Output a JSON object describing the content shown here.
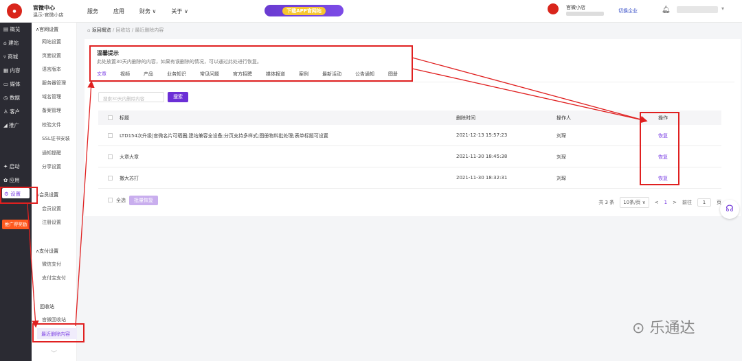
{
  "brand": {
    "logo_text": "官微中心",
    "name": "官微中心",
    "sub": "温示-官微小店"
  },
  "topnav": [
    "服务",
    "应用",
    "财务 ∨",
    "关于 ∨"
  ],
  "app_banner": "下载APP官网站",
  "shop": {
    "name": "官微小店",
    "switch": "切换企业"
  },
  "sidebar1": [
    "概览",
    "建站",
    "商城",
    "内容",
    "媒体",
    "数据",
    "客户",
    "推广",
    "启动",
    "应用",
    "设置"
  ],
  "promo": "推广得奖励",
  "sidebar2": {
    "group1": "∧官网设置",
    "items1": [
      "网站设置",
      "页面设置",
      "语言版本",
      "服务器管理",
      "域名管理",
      "备案管理",
      "校验文件",
      "SSL证书安装",
      "通知提醒",
      "分享设置"
    ],
    "group2": "∧会员设置",
    "items2": [
      "会员设置",
      "注册设置"
    ],
    "group3": "∧支付设置",
    "items3": [
      "微信支付",
      "支付宝支付"
    ],
    "group4": "回收站",
    "items4": [
      "官微回收站"
    ],
    "active": "最近删除内容"
  },
  "breadcrumb": {
    "back": "返回概览",
    "mid": "回收站",
    "current": "最近删除内容"
  },
  "tip": {
    "title": "温馨提示",
    "desc": "此处放置30天内删除的内容，如果有误删除的情况，可以通过此处进行恢复。"
  },
  "tabs": [
    "文章",
    "视频",
    "产品",
    "业务知识",
    "常见问题",
    "官方招聘",
    "媒体报道",
    "案例",
    "最新活动",
    "公告通知",
    "图册"
  ],
  "search": {
    "placeholder": "搜索30天内删除内容",
    "button": "搜索"
  },
  "table": {
    "headers": {
      "title": "标题",
      "time": "删除时间",
      "operator": "操作人",
      "action": "操作"
    },
    "rows": [
      {
        "title": "LTD154次升级|官微名片可晒圈;建站兼容全设备;分页支持多样式;图册物料批处理;表单标题可设置",
        "time": "2021-12-13 15:57:23",
        "operator": "刘琛",
        "action": "恢复"
      },
      {
        "title": "大章大章",
        "time": "2021-11-30 18:45:38",
        "operator": "刘琛",
        "action": "恢复"
      },
      {
        "title": "撒大苏打",
        "time": "2021-11-30 18:32:31",
        "operator": "刘琛",
        "action": "恢复"
      }
    ]
  },
  "footer": {
    "select_all": "全选",
    "batch": "批量恢复",
    "total": "共 3 条",
    "page_size": "10条/页 ∨",
    "prev": "<",
    "page": "1",
    "next": ">",
    "goto": "前往",
    "goto_val": "1",
    "page_unit": "页"
  },
  "watermark": "乐通达",
  "icons": {
    "bell": "bell-icon",
    "home": "home-icon",
    "support": "support-icon"
  }
}
